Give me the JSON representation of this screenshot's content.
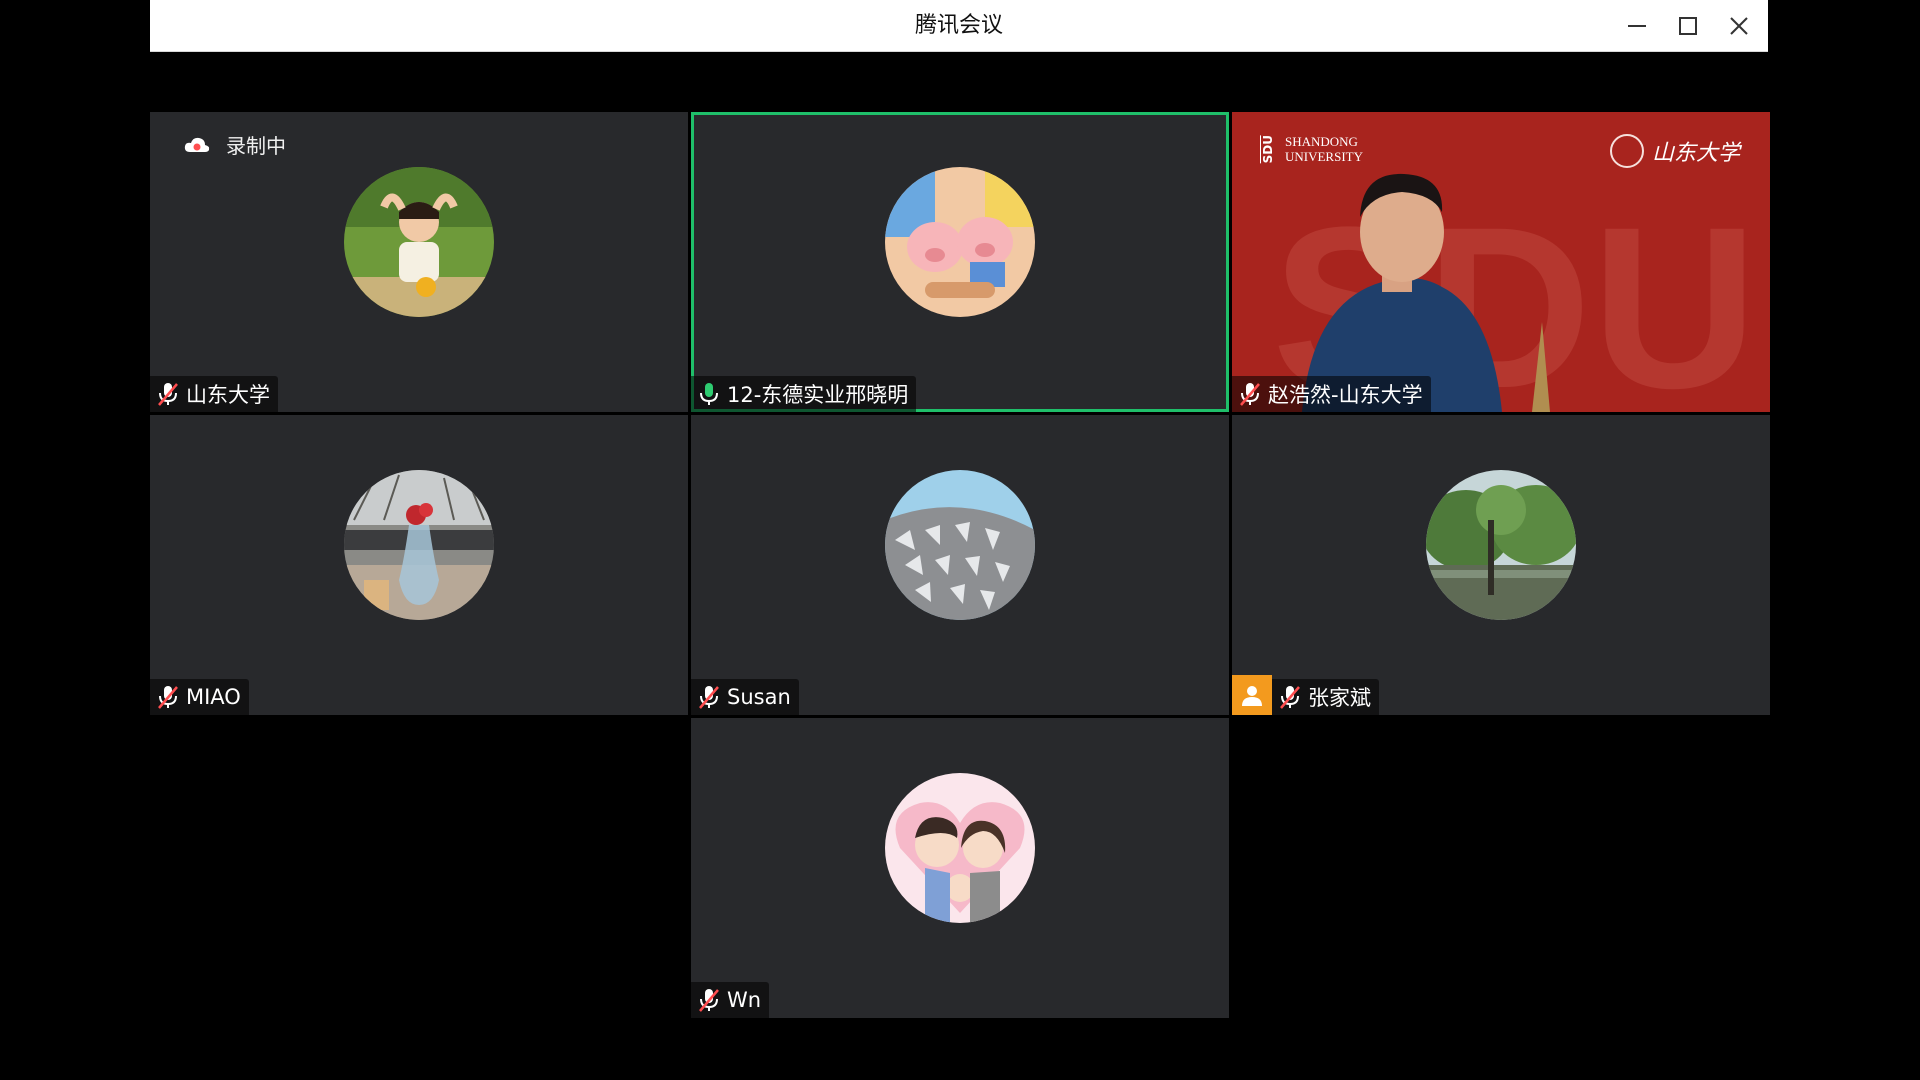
{
  "window": {
    "title": "腾讯会议",
    "controls": [
      "minimize-icon",
      "maximize-icon",
      "close-icon"
    ]
  },
  "recording": {
    "label": "录制中",
    "icon": "cloud-record-icon"
  },
  "colors": {
    "active_speaker_border": "#1fbf6a",
    "tile_bg": "#28292c",
    "host_badge": "#f39a1e",
    "muted_mic": "#ff4d4f",
    "active_mic": "#2ecc71"
  },
  "participants": [
    {
      "name": "山东大学",
      "mic": "muted",
      "avatar": "child-photo"
    },
    {
      "name": "12-东德实业邢晓明",
      "mic": "speaking",
      "avatar": "cartoon-pigs",
      "active": true
    },
    {
      "name": "赵浩然-山东大学",
      "mic": "muted",
      "video": "on",
      "background": {
        "brand_mark": "SDU",
        "brand_text": [
          "SHANDONG",
          "UNIVERSITY"
        ],
        "logo_text": "山东大学"
      }
    },
    {
      "name": "MIAO",
      "mic": "muted",
      "avatar": "flower-vase"
    },
    {
      "name": "Susan",
      "mic": "muted",
      "avatar": "building"
    },
    {
      "name": "张家斌",
      "mic": "muted",
      "avatar": "trees-pond",
      "host": true
    },
    {
      "name": "Wn",
      "mic": "muted",
      "avatar": "cartoon-family"
    }
  ]
}
